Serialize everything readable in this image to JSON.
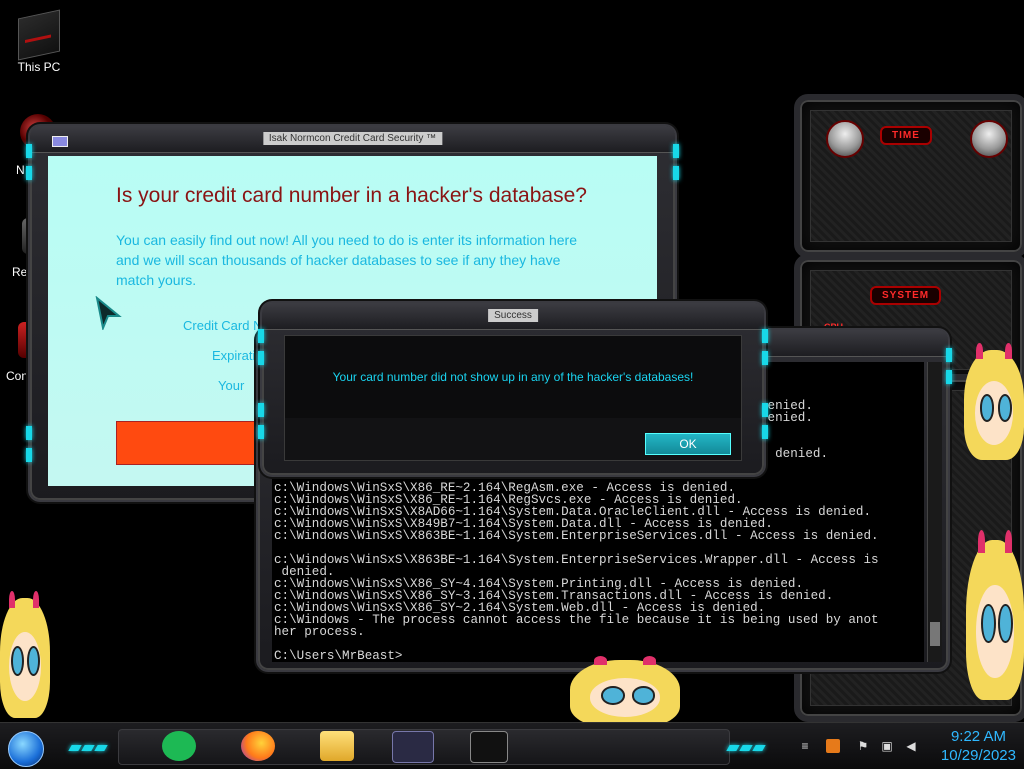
{
  "desktop": {
    "icons": [
      {
        "label": "This PC"
      },
      {
        "label": "N"
      },
      {
        "label": "Rec"
      },
      {
        "label": "Contr"
      }
    ]
  },
  "cc_window": {
    "title": "Isak Normcon Credit Card Security ™",
    "heading": "Is your credit card number in a hacker's database?",
    "description": "You can easily find out now! All you need to do is enter its information here and we will scan thousands of hacker databases to see if any they have match yours.",
    "fields": [
      "Credit Card N",
      "Expirati",
      "Your "
    ],
    "submit_color": "#ff4a10"
  },
  "dialog": {
    "title": "Success",
    "message": "Your card number did not show up in any of the hacker's databases!",
    "ok_label": "OK"
  },
  "console": {
    "text": "ounters.dll - Acce\n\n\n\n\n\n\n\n\n\nc:\\Windows\\WinSxS\\X86_RE~2.164\\RegAsm.exe - Access is denied.\nc:\\Windows\\WinSxS\\X86_RE~1.164\\RegSvcs.exe - Access is denied.\nc:\\Windows\\WinSxS\\X8AD66~1.164\\System.Data.OracleClient.dll - Access is denied.\nc:\\Windows\\WinSxS\\X849B7~1.164\\System.Data.dll - Access is denied.\nc:\\Windows\\WinSxS\\X863BE~1.164\\System.EnterpriseServices.dll - Access is denied.\n\nc:\\Windows\\WinSxS\\X863BE~1.164\\System.EnterpriseServices.Wrapper.dll - Access is\n denied.\nc:\\Windows\\WinSxS\\X86_SY~4.164\\System.Printing.dll - Access is denied.\nc:\\Windows\\WinSxS\\X86_SY~3.164\\System.Transactions.dll - Access is denied.\nc:\\Windows\\WinSxS\\X86_SY~2.164\\System.Web.dll - Access is denied.\nc:\\Windows - The process cannot access the file because it is being used by anot\nher process.\n\nC:\\Users\\MrBeast>",
    "peek_lines": [
      "denied.",
      "denied.",
      "s denied."
    ]
  },
  "widgets": {
    "time_label": "TIME",
    "system_label": "SYSTEM",
    "cpu_label": "CPU"
  },
  "taskbar": {
    "apps": [
      {
        "name": "spotify",
        "color": "#1db954"
      },
      {
        "name": "firefox",
        "color": "#ff7a1a"
      },
      {
        "name": "file-explorer",
        "color": "#f2c94c"
      },
      {
        "name": "credit-card-app",
        "color": "#6a6ae0"
      },
      {
        "name": "command-prompt",
        "color": "#222222"
      }
    ],
    "time": "9:22 AM",
    "date": "10/29/2023",
    "accent": "#18d8e8"
  }
}
